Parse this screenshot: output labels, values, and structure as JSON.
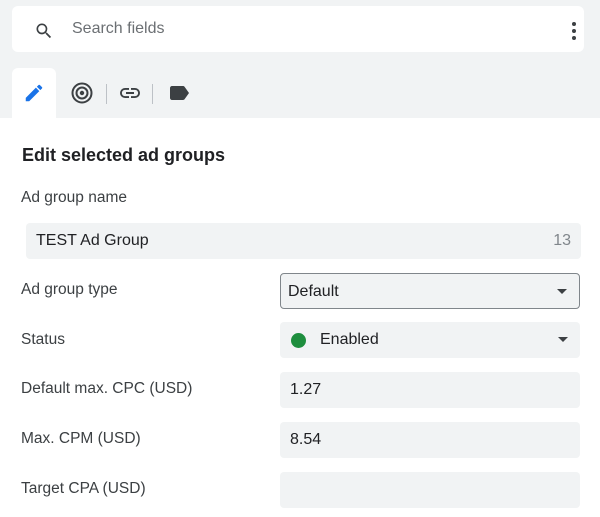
{
  "search": {
    "placeholder": "Search fields"
  },
  "tabs": [
    {
      "icon": "edit-pencil-icon",
      "active": true
    },
    {
      "icon": "target-icon",
      "active": false
    },
    {
      "icon": "link-icon",
      "active": false
    },
    {
      "icon": "label-icon",
      "active": false
    }
  ],
  "colors": {
    "accent": "#1a73e8",
    "status_enabled": "#1e8e3e",
    "panel_bg": "#ffffff",
    "page_bg": "#f1f3f4"
  },
  "form": {
    "title": "Edit selected ad groups",
    "ad_group_name": {
      "label": "Ad group name",
      "value": "TEST Ad Group",
      "char_count": "13"
    },
    "ad_group_type": {
      "label": "Ad group type",
      "selected": "Default"
    },
    "status": {
      "label": "Status",
      "selected": "Enabled"
    },
    "default_max_cpc": {
      "label": "Default max. CPC (USD)",
      "value": "1.27"
    },
    "max_cpm": {
      "label": "Max. CPM (USD)",
      "value": "8.54"
    },
    "target_cpa": {
      "label": "Target CPA (USD)",
      "value": ""
    }
  }
}
